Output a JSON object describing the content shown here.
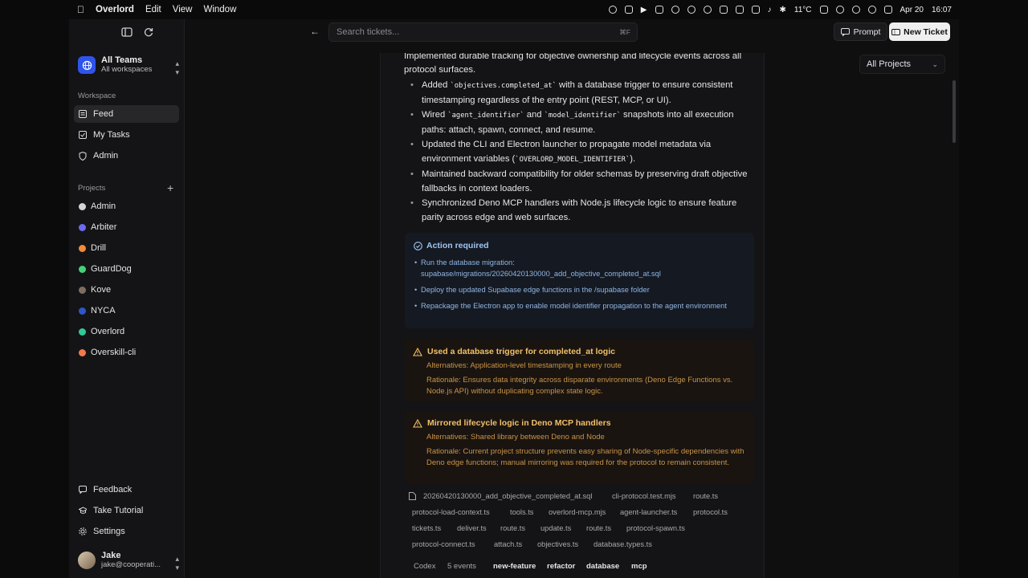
{
  "menubar": {
    "app": "Overlord",
    "menus": [
      "Edit",
      "View",
      "Window"
    ],
    "weather": "11°C",
    "date": "Apr 20",
    "time": "16:07"
  },
  "sidebar": {
    "team_name": "All Teams",
    "team_sub": "All workspaces",
    "workspace_label": "Workspace",
    "workspace_items": [
      {
        "label": "Feed",
        "icon": "feed-icon",
        "active": true
      },
      {
        "label": "My Tasks",
        "icon": "tasks-icon",
        "active": false
      },
      {
        "label": "Admin",
        "icon": "shield-icon",
        "active": false
      }
    ],
    "projects_label": "Projects",
    "projects": [
      {
        "label": "Admin",
        "color": "#d4d4d8"
      },
      {
        "label": "Arbiter",
        "color": "#6b6bf0"
      },
      {
        "label": "Drill",
        "color": "#f08a3c"
      },
      {
        "label": "GuardDog",
        "color": "#44d07a"
      },
      {
        "label": "Kove",
        "color": "#7c6f62"
      },
      {
        "label": "NYCA",
        "color": "#2f56c8"
      },
      {
        "label": "Overlord",
        "color": "#34c79a"
      },
      {
        "label": "Overskill-cli",
        "color": "#f07a4c"
      }
    ],
    "bottom_items": [
      {
        "label": "Feedback",
        "icon": "feedback-icon"
      },
      {
        "label": "Take Tutorial",
        "icon": "tutorial-icon"
      },
      {
        "label": "Settings",
        "icon": "gear-icon"
      }
    ],
    "user_name": "Jake",
    "user_email": "jake@cooperati..."
  },
  "topbar": {
    "search_placeholder": "Search tickets...",
    "search_shortcut": "⌘F",
    "prompt_label": "Prompt",
    "new_ticket_label": "New Ticket"
  },
  "filter": {
    "project_select": "All Projects"
  },
  "ticket": {
    "intro": "Implemented durable tracking for objective ownership and lifecycle events across all protocol surfaces.",
    "bullets": [
      {
        "pre": "Added ",
        "code": "`objectives.completed_at`",
        "post": " with a database trigger to ensure consistent timestamping regardless of the entry point (REST, MCP, or UI)."
      },
      {
        "pre": "Wired ",
        "code": "`agent_identifier`",
        "mid": " and ",
        "code2": "`model_identifier`",
        "post": " snapshots into all execution paths: attach, spawn, connect, and resume."
      },
      {
        "pre": "Updated the CLI and Electron launcher to propagate model metadata via environment variables (",
        "code": "`OVERLORD_MODEL_IDENTIFIER`",
        "post": ")."
      },
      {
        "pre": "Maintained backward compatibility for older schemas by preserving draft objective fallbacks in context loaders."
      },
      {
        "pre": "Synchronized Deno MCP handlers with Node.js lifecycle logic to ensure feature parity across edge and web surfaces."
      }
    ],
    "action": {
      "title": "Action required",
      "items": [
        "Run the database migration: supabase/migrations/20260420130000_add_objective_completed_at.sql",
        "Deploy the updated Supabase edge functions in the /supabase folder",
        "Repackage the Electron app to enable model identifier propagation to the agent environment"
      ]
    },
    "decisions": [
      {
        "title": "Used a database trigger for completed_at logic",
        "alternatives": "Alternatives: Application-level timestamping in every route",
        "rationale": "Rationale: Ensures data integrity across disparate environments (Deno Edge Functions vs. Node.js API) without duplicating complex state logic."
      },
      {
        "title": "Mirrored lifecycle logic in Deno MCP handlers",
        "alternatives": "Alternatives: Shared library between Deno and Node",
        "rationale": "Rationale: Current project structure prevents easy sharing of Node-specific dependencies with Deno edge functions; manual mirroring was required for the protocol to remain consistent."
      }
    ],
    "files": [
      "20260420130000_add_objective_completed_at.sql",
      "cli-protocol.test.mjs",
      "route.ts",
      "protocol-load-context.ts",
      "tools.ts",
      "overlord-mcp.mjs",
      "agent-launcher.ts",
      "protocol.ts",
      "tickets.ts",
      "deliver.ts",
      "route.ts",
      "update.ts",
      "route.ts",
      "protocol-spawn.ts",
      "protocol-connect.ts",
      "attach.ts",
      "objectives.ts",
      "database.types.ts"
    ],
    "footer": {
      "agent": "Codex",
      "events": "5 events",
      "tags": [
        "new-feature",
        "refactor",
        "database",
        "mcp"
      ]
    }
  }
}
